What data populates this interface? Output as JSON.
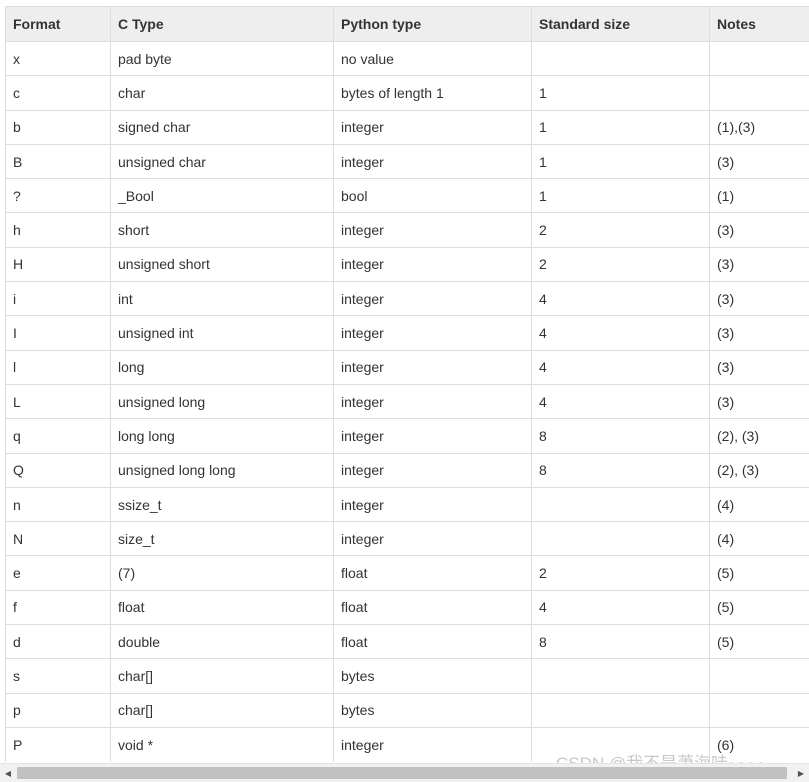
{
  "table": {
    "headers": [
      "Format",
      "C Type",
      "Python type",
      "Standard size",
      "Notes"
    ],
    "rows": [
      [
        "x",
        "pad byte",
        "no value",
        "",
        ""
      ],
      [
        "c",
        "char",
        "bytes of length 1",
        "1",
        ""
      ],
      [
        "b",
        "signed char",
        "integer",
        "1",
        "(1),(3)"
      ],
      [
        "B",
        "unsigned char",
        "integer",
        "1",
        "(3)"
      ],
      [
        "?",
        "_Bool",
        "bool",
        "1",
        "(1)"
      ],
      [
        "h",
        "short",
        "integer",
        "2",
        "(3)"
      ],
      [
        "H",
        "unsigned short",
        "integer",
        "2",
        "(3)"
      ],
      [
        "i",
        "int",
        "integer",
        "4",
        "(3)"
      ],
      [
        "I",
        "unsigned int",
        "integer",
        "4",
        "(3)"
      ],
      [
        "l",
        "long",
        "integer",
        "4",
        "(3)"
      ],
      [
        "L",
        "unsigned long",
        "integer",
        "4",
        "(3)"
      ],
      [
        "q",
        "long long",
        "integer",
        "8",
        "(2), (3)"
      ],
      [
        "Q",
        "unsigned long long",
        "integer",
        "8",
        "(2), (3)"
      ],
      [
        "n",
        "ssize_t",
        "integer",
        "",
        "(4)"
      ],
      [
        "N",
        "size_t",
        "integer",
        "",
        "(4)"
      ],
      [
        "e",
        "(7)",
        "float",
        "2",
        "(5)"
      ],
      [
        "f",
        "float",
        "float",
        "4",
        "(5)"
      ],
      [
        "d",
        "double",
        "float",
        "8",
        "(5)"
      ],
      [
        "s",
        "char[]",
        "bytes",
        "",
        ""
      ],
      [
        "p",
        "char[]",
        "bytes",
        "",
        ""
      ],
      [
        "P",
        "void *",
        "integer",
        "",
        "(6)"
      ]
    ]
  },
  "watermark": "CSDN @我不是萧海哇~~~~",
  "scrollbar": {
    "left_arrow": "◀",
    "right_arrow": "▶"
  }
}
